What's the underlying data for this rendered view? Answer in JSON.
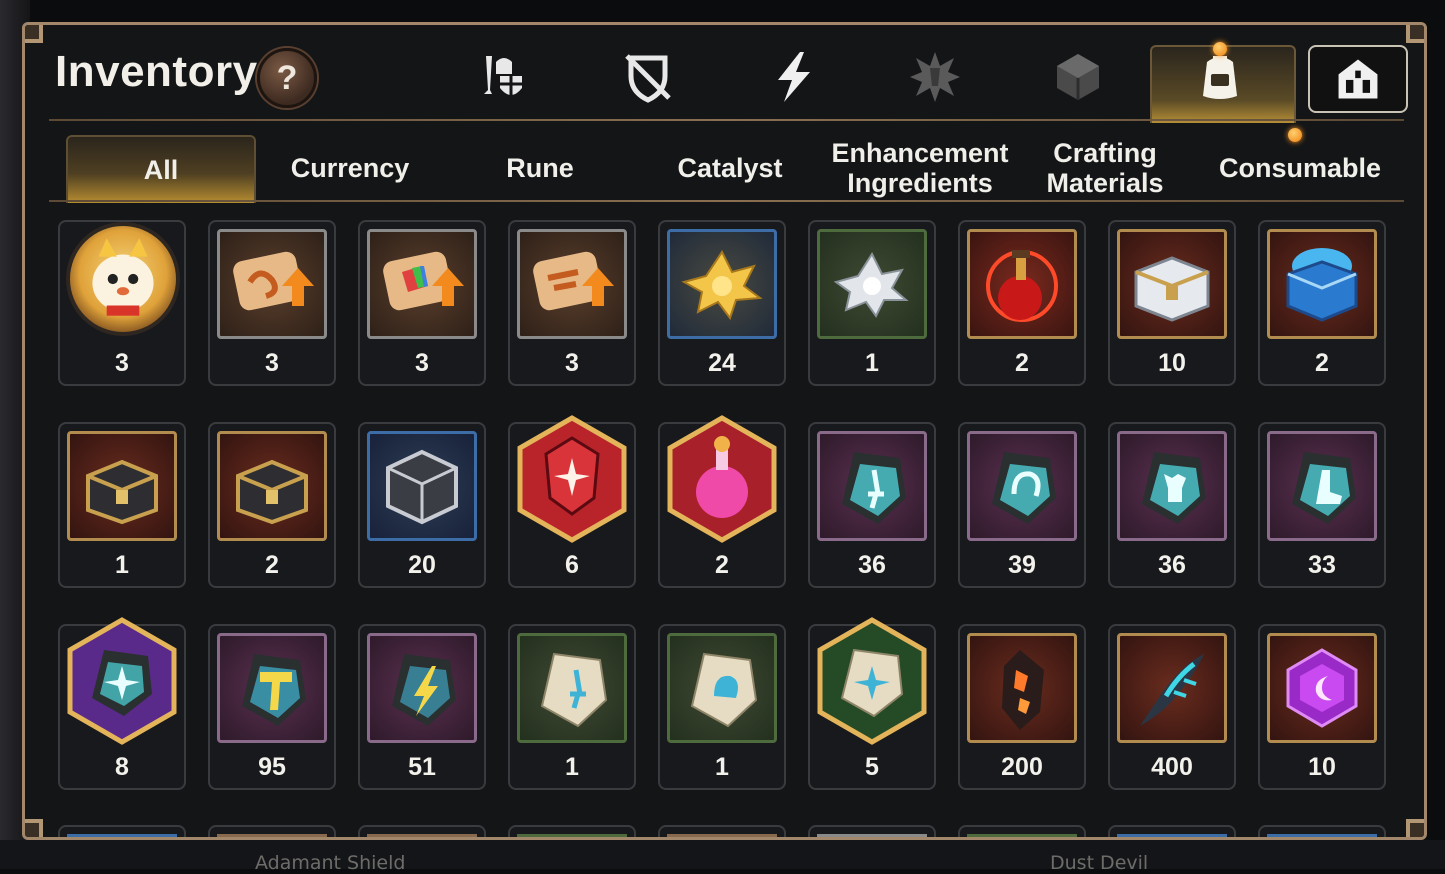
{
  "header": {
    "title": "Inventory",
    "help_label": "?"
  },
  "categories": [
    {
      "icon": "sword-helmet-shield-icon",
      "active": false
    },
    {
      "icon": "crossed-shield-icon",
      "active": false
    },
    {
      "icon": "lightning-icon",
      "active": false
    },
    {
      "icon": "burst-emblem-icon",
      "active": false
    },
    {
      "icon": "cube-icon",
      "active": false
    },
    {
      "icon": "backpack-icon",
      "active": true
    },
    {
      "icon": "castle-icon",
      "active": false
    }
  ],
  "tabs": [
    {
      "label": "All",
      "active": true
    },
    {
      "label": "Currency",
      "active": false
    },
    {
      "label": "Rune",
      "active": false
    },
    {
      "label": "Catalyst",
      "active": false
    },
    {
      "label": "Enhancement Ingredients",
      "active": false
    },
    {
      "label": "Crafting Materials",
      "active": false
    },
    {
      "label": "Consumable",
      "active": false
    }
  ],
  "items": [
    [
      {
        "icon": "mascot-coin-icon",
        "qty": "3"
      },
      {
        "icon": "scroll-upgrade-icon",
        "qty": "3"
      },
      {
        "icon": "rainbow-scroll-upgrade-icon",
        "qty": "3"
      },
      {
        "icon": "scroll-upgrade-icon",
        "qty": "3"
      },
      {
        "icon": "gold-crystal-cluster-icon",
        "qty": "24"
      },
      {
        "icon": "silver-crystal-cluster-icon",
        "qty": "1"
      },
      {
        "icon": "red-potion-icon",
        "qty": "2"
      },
      {
        "icon": "silver-chest-icon",
        "qty": "10"
      },
      {
        "icon": "blue-chest-icon",
        "qty": "2"
      }
    ],
    [
      {
        "icon": "dark-chest-icon",
        "qty": "1"
      },
      {
        "icon": "dark-chest-icon",
        "qty": "2"
      },
      {
        "icon": "dark-cube-chest-icon",
        "qty": "20"
      },
      {
        "icon": "red-star-gem-icon",
        "qty": "6"
      },
      {
        "icon": "pink-potion-icon",
        "qty": "2"
      },
      {
        "icon": "sword-rune-stone-icon",
        "qty": "36"
      },
      {
        "icon": "helmet-rune-stone-icon",
        "qty": "39"
      },
      {
        "icon": "armor-rune-stone-icon",
        "qty": "36"
      },
      {
        "icon": "boot-rune-stone-icon",
        "qty": "33"
      }
    ],
    [
      {
        "icon": "star-rune-stone-icon",
        "qty": "8"
      },
      {
        "icon": "hammer-rune-stone-icon",
        "qty": "95"
      },
      {
        "icon": "bolt-rune-stone-icon",
        "qty": "51"
      },
      {
        "icon": "sword-pale-stone-icon",
        "qty": "1"
      },
      {
        "icon": "helmet-pale-stone-icon",
        "qty": "1"
      },
      {
        "icon": "star-pale-stone-icon",
        "qty": "5"
      },
      {
        "icon": "magma-shard-icon",
        "qty": "200"
      },
      {
        "icon": "cyan-feather-icon",
        "qty": "400"
      },
      {
        "icon": "purple-moon-gem-icon",
        "qty": "10"
      }
    ]
  ],
  "background": {
    "bottom_left": "Adamant Shield",
    "bottom_right": "Dust Devil"
  },
  "colors": {
    "panel_border": "#a2876a",
    "accent_gold": "#b68d30",
    "notification": "#f08010"
  }
}
